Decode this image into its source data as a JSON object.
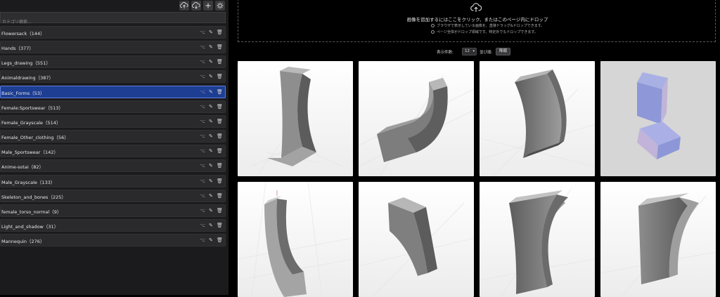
{
  "sidebar": {
    "search_placeholder": "カテゴリ検索...",
    "toolbar": [
      "upload-icon",
      "download-icon",
      "add-icon",
      "settings-icon"
    ],
    "categories": [
      {
        "label": "Flowersack（144）"
      },
      {
        "label": "Hands（377）"
      },
      {
        "label": "Legs_drawing（551）"
      },
      {
        "label": "Animaldrawing（387）"
      },
      {
        "label": "Basic_Forms（53）",
        "active": true
      },
      {
        "label": "Female:Sportswear（513）"
      },
      {
        "label": "Female_Grayscale（514）"
      },
      {
        "label": "Female_Other_clothing（56）"
      },
      {
        "label": "Male_Sportswear（142）"
      },
      {
        "label": "Anime-sotai（82）"
      },
      {
        "label": "Male_Grayscale（133）"
      },
      {
        "label": "Skeleton_and_bones（225）"
      },
      {
        "label": "female_torso_normal（9）"
      },
      {
        "label": "Light_and_shadow（31）"
      },
      {
        "label": "Mannequin（276）"
      }
    ]
  },
  "dropzone": {
    "title": "画像を追加するにはここをクリック、またはこのページ内にドロップ",
    "note1": "ブラウザで表示している画像を、直接ドラッグ&ドロップできます。",
    "note2": "ページ全体がドロップ領域です。特定外でもドロップできます。"
  },
  "controls": {
    "count_label": "表示件数:",
    "count_value": "12",
    "sort_label": "並び順:",
    "sort_button": "降順"
  },
  "colors": {
    "accent": "#1e3e93",
    "accent_border": "#5d81e0",
    "background": "#000000",
    "sidebar": "#1b1b1d"
  }
}
